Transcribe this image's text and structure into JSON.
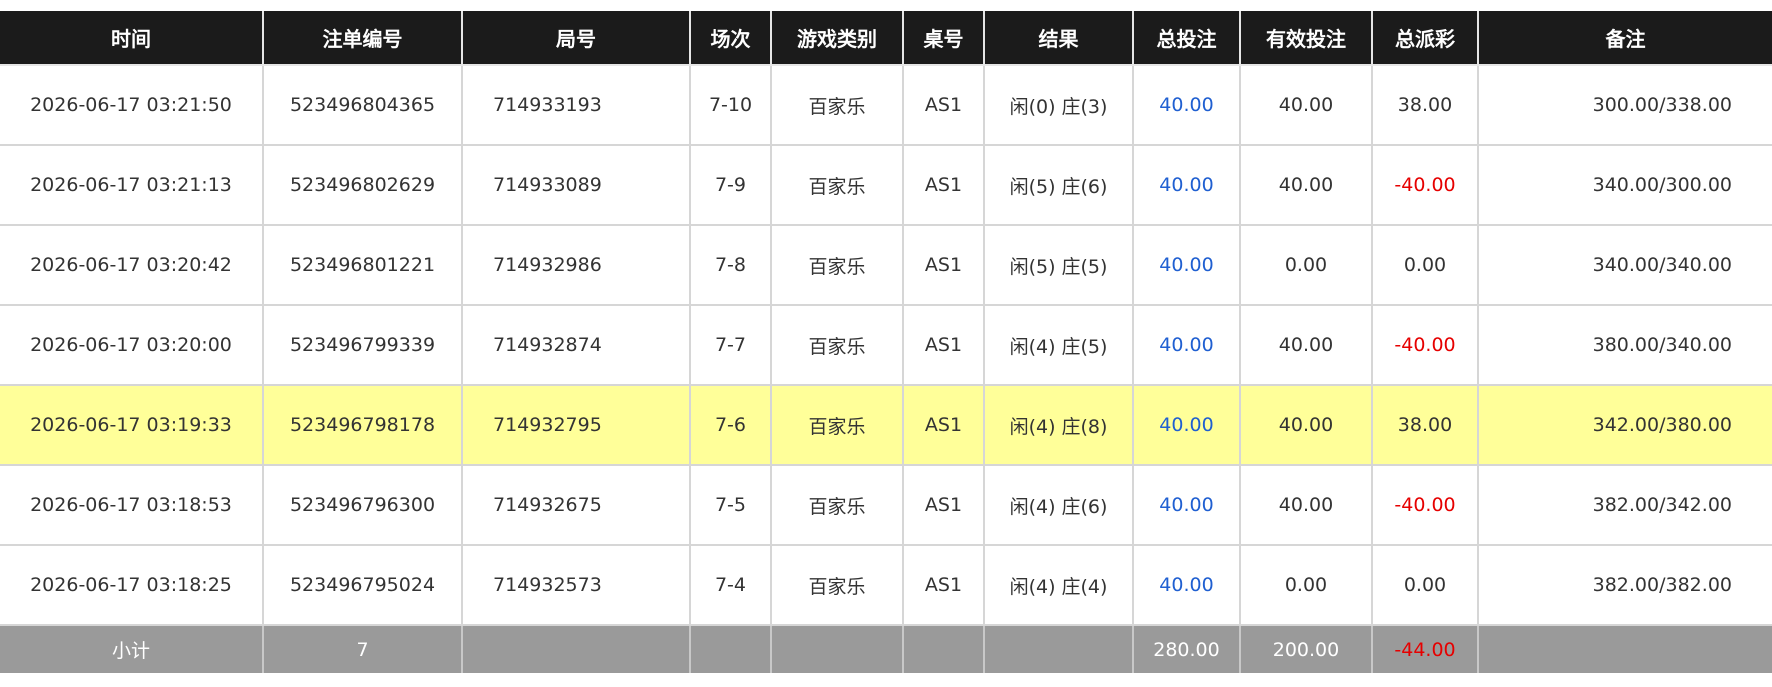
{
  "columns": [
    "时间",
    "注单编号",
    "局号",
    "场次",
    "游戏类别",
    "桌号",
    "结果",
    "总投注",
    "有效投注",
    "总派彩",
    "备注"
  ],
  "rows": [
    {
      "time": "2026-06-17 03:21:50",
      "bet_id": "523496804365",
      "round_id": "714933193",
      "session": "7-10",
      "game": "百家乐",
      "table": "AS1",
      "result": "闲(0) 庄(3)",
      "total_bet": "40.00",
      "valid_bet": "40.00",
      "payout": "38.00",
      "payout_negative": false,
      "remark": "300.00/338.00",
      "highlight": false
    },
    {
      "time": "2026-06-17 03:21:13",
      "bet_id": "523496802629",
      "round_id": "714933089",
      "session": "7-9",
      "game": "百家乐",
      "table": "AS1",
      "result": "闲(5) 庄(6)",
      "total_bet": "40.00",
      "valid_bet": "40.00",
      "payout": "-40.00",
      "payout_negative": true,
      "remark": "340.00/300.00",
      "highlight": false
    },
    {
      "time": "2026-06-17 03:20:42",
      "bet_id": "523496801221",
      "round_id": "714932986",
      "session": "7-8",
      "game": "百家乐",
      "table": "AS1",
      "result": "闲(5) 庄(5)",
      "total_bet": "40.00",
      "valid_bet": "0.00",
      "payout": "0.00",
      "payout_negative": false,
      "remark": "340.00/340.00",
      "highlight": false
    },
    {
      "time": "2026-06-17 03:20:00",
      "bet_id": "523496799339",
      "round_id": "714932874",
      "session": "7-7",
      "game": "百家乐",
      "table": "AS1",
      "result": "闲(4) 庄(5)",
      "total_bet": "40.00",
      "valid_bet": "40.00",
      "payout": "-40.00",
      "payout_negative": true,
      "remark": "380.00/340.00",
      "highlight": false
    },
    {
      "time": "2026-06-17 03:19:33",
      "bet_id": "523496798178",
      "round_id": "714932795",
      "session": "7-6",
      "game": "百家乐",
      "table": "AS1",
      "result": "闲(4) 庄(8)",
      "total_bet": "40.00",
      "valid_bet": "40.00",
      "payout": "38.00",
      "payout_negative": false,
      "remark": "342.00/380.00",
      "highlight": true
    },
    {
      "time": "2026-06-17 03:18:53",
      "bet_id": "523496796300",
      "round_id": "714932675",
      "session": "7-5",
      "game": "百家乐",
      "table": "AS1",
      "result": "闲(4) 庄(6)",
      "total_bet": "40.00",
      "valid_bet": "40.00",
      "payout": "-40.00",
      "payout_negative": true,
      "remark": "382.00/342.00",
      "highlight": false
    },
    {
      "time": "2026-06-17 03:18:25",
      "bet_id": "523496795024",
      "round_id": "714932573",
      "session": "7-4",
      "game": "百家乐",
      "table": "AS1",
      "result": "闲(4) 庄(4)",
      "total_bet": "40.00",
      "valid_bet": "0.00",
      "payout": "0.00",
      "payout_negative": false,
      "remark": "382.00/382.00",
      "highlight": false
    }
  ],
  "subtotal": {
    "label": "小计",
    "count": "7",
    "total_bet": "280.00",
    "valid_bet": "200.00",
    "payout": "-44.00"
  },
  "colors": {
    "header_bg": "#1b1b1b",
    "highlight_row": "#ffff99",
    "total_bet_text": "#1f5fd1",
    "negative_payout": "#e60000",
    "subtotal_bg": "#9a9a9a"
  }
}
